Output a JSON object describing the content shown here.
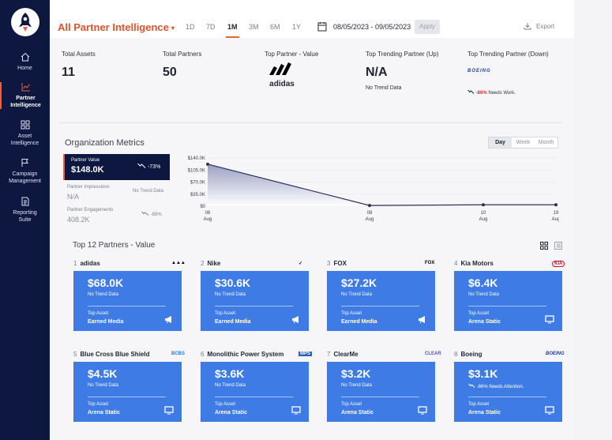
{
  "sidebar": {
    "items": [
      {
        "label_1": "Home",
        "label_2": ""
      },
      {
        "label_1": "Partner",
        "label_2": "Intelligence"
      },
      {
        "label_1": "Asset",
        "label_2": "Intelligence"
      },
      {
        "label_1": "Campaign",
        "label_2": "Management"
      },
      {
        "label_1": "Reporting",
        "label_2": "Suite"
      }
    ],
    "active_index": 1
  },
  "header": {
    "title": "All Partner Intelligence",
    "caret": "▾",
    "ranges": [
      "1D",
      "7D",
      "1M",
      "3M",
      "6M",
      "1Y"
    ],
    "active_range": "1M",
    "date_range": "08/05/2023  - 09/05/2023",
    "apply_label": "Apply",
    "export_label": "Export"
  },
  "kpis": {
    "total_assets_label": "Total Assets",
    "total_assets": "11",
    "total_partners_label": "Total Partners",
    "total_partners": "50",
    "top_partner_label": "Top Partner - Value",
    "top_partner_logo": "adidas",
    "trending_up_label": "Top Trending Partner (Up)",
    "trending_up_value": "N/A",
    "trending_up_note": "No Trend Data",
    "trending_down_label": "Top Trending Partner (Down)",
    "trending_down_logo": "BOEING",
    "trending_down_pct": "-86%",
    "trending_down_note": "Needs Work."
  },
  "org_metrics": {
    "title": "Organization Metrics",
    "toggle": [
      "Day",
      "Week",
      "Month"
    ],
    "toggle_active": "Day",
    "partner_value_label": "Partner Value",
    "partner_value": "$148.0K",
    "partner_value_change": "-73%",
    "impressions_label": "Partner Impressions",
    "impressions_value": "N/A",
    "impressions_note": "No Trend Data",
    "engagements_label": "Partner Engagements",
    "engagements_value": "408.2K",
    "engagements_change": "-89%"
  },
  "chart_data": {
    "type": "area",
    "x": [
      "06 Aug",
      "08 Aug",
      "10 Aug",
      "19 Aug"
    ],
    "y_tick_labels": [
      "$140.0K",
      "$105.0K",
      "$70.0K",
      "$35.0K",
      "$0"
    ],
    "ylim": [
      0,
      140000
    ],
    "points": [
      {
        "x": "06 Aug",
        "y": 122000
      },
      {
        "x": "08 Aug",
        "y": 2000
      },
      {
        "x": "10 Aug",
        "y": 4000
      },
      {
        "x": "19 Aug",
        "y": 4000
      }
    ],
    "colors": {
      "line": "#2b2f5a",
      "fill_top": "#9aa0c2",
      "fill_bottom": "#ffffff"
    }
  },
  "partners": {
    "title": "Top 12 Partners - Value",
    "top_asset_label": "Top Asset",
    "items": [
      {
        "index": "1",
        "name": "adidas",
        "logo": "adidas",
        "value": "$68.0K",
        "note": "No Trend Data",
        "asset": "Earned Media",
        "asset_icon": "megaphone"
      },
      {
        "index": "2",
        "name": "Nike",
        "logo": "swoosh",
        "value": "$30.6K",
        "note": "No Trend Data",
        "asset": "Earned Media",
        "asset_icon": "megaphone"
      },
      {
        "index": "3",
        "name": "FOX",
        "logo": "FOX",
        "value": "$27.2K",
        "note": "No Trend Data",
        "asset": "Earned Media",
        "asset_icon": "megaphone"
      },
      {
        "index": "4",
        "name": "Kia Motors",
        "logo": "KIA",
        "value": "$6.4K",
        "note": "No Trend Data",
        "asset": "Arena Static",
        "asset_icon": "screen"
      },
      {
        "index": "5",
        "name": "Blue Cross Blue Shield",
        "logo": "BCBS",
        "value": "$4.5K",
        "note": "No Trend Data",
        "asset": "Arena Static",
        "asset_icon": "screen"
      },
      {
        "index": "6",
        "name": "Monolithic Power System",
        "logo": "MPS",
        "value": "$3.6K",
        "note": "No Trend Data",
        "asset": "Arena Static",
        "asset_icon": "screen"
      },
      {
        "index": "7",
        "name": "ClearMe",
        "logo": "CLEAR",
        "value": "$3.2K",
        "note": "No Trend Data",
        "asset": "Arena Static",
        "asset_icon": "screen"
      },
      {
        "index": "8",
        "name": "Boeing",
        "logo": "BOEING",
        "value": "$3.1K",
        "note_pct": "-86%",
        "note": "Needs Attention.",
        "asset": "Arena Static",
        "asset_icon": "screen"
      }
    ]
  },
  "colors": {
    "sidebar": "#0e1740",
    "accent": "#e8623b",
    "card": "#3e7be4",
    "negative": "#d0312d"
  }
}
